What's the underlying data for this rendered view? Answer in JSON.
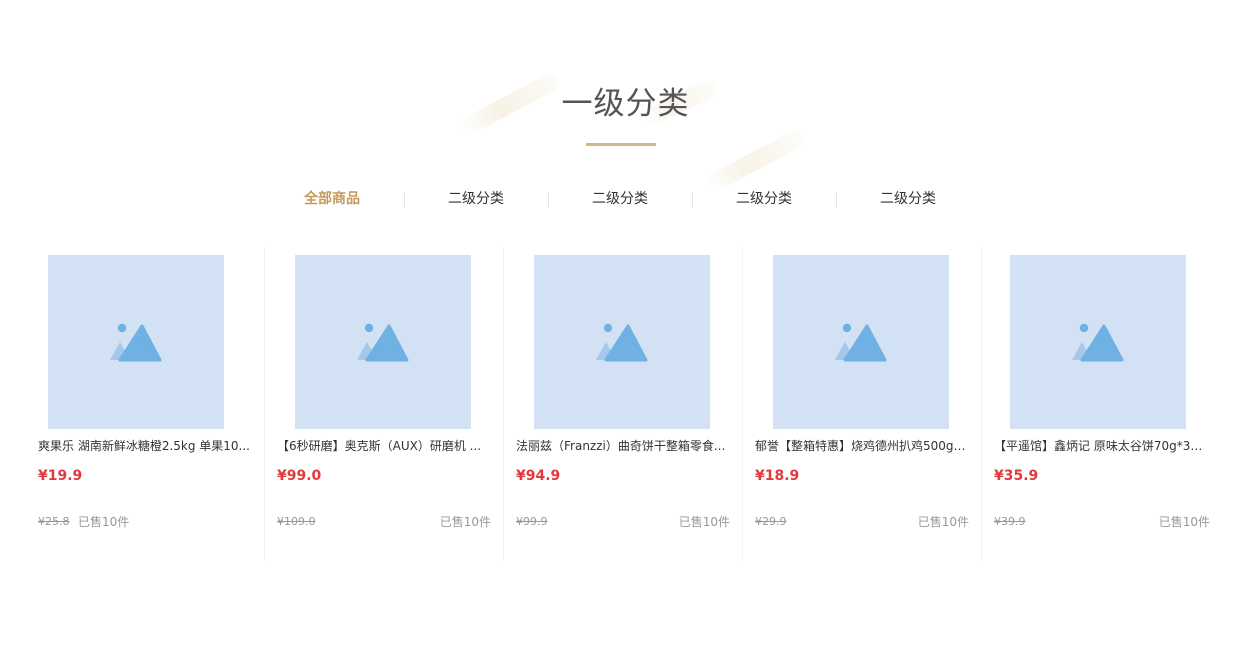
{
  "header": {
    "title": "一级分类"
  },
  "tabs": [
    {
      "label": "全部商品",
      "active": true
    },
    {
      "label": "二级分类",
      "active": false
    },
    {
      "label": "二级分类",
      "active": false
    },
    {
      "label": "二级分类",
      "active": false
    },
    {
      "label": "二级分类",
      "active": false
    }
  ],
  "products": [
    {
      "name": "爽果乐 湖南新鲜冰糖橙2.5kg 单果10...",
      "price": "¥19.9",
      "original_price": "¥25.8",
      "sold": "已售10件",
      "image_icon": "image-placeholder-icon"
    },
    {
      "name": "【6秒研磨】奥克斯（AUX）研磨机 ...",
      "price": "¥99.0",
      "original_price": "¥109.0",
      "sold": "已售10件",
      "image_icon": "image-placeholder-icon"
    },
    {
      "name": "法丽兹（Franzzi）曲奇饼干整箱零食...",
      "price": "¥94.9",
      "original_price": "¥99.9",
      "sold": "已售10件",
      "image_icon": "image-placeholder-icon"
    },
    {
      "name": "郁誉【整箱特惠】烧鸡德州扒鸡500g ...",
      "price": "¥18.9",
      "original_price": "¥29.9",
      "sold": "已售10件",
      "image_icon": "image-placeholder-icon"
    },
    {
      "name": "【平遥馆】鑫炳记 原味太谷饼70g*30...",
      "price": "¥35.9",
      "original_price": "¥39.9",
      "sold": "已售10件",
      "image_icon": "image-placeholder-icon"
    }
  ],
  "colors": {
    "accent": "#c49a5c",
    "underline": "#d4b78f",
    "price": "#e4393c",
    "placeholder_bg": "#d2e2f4",
    "placeholder_icon": "#6fb1e3"
  }
}
